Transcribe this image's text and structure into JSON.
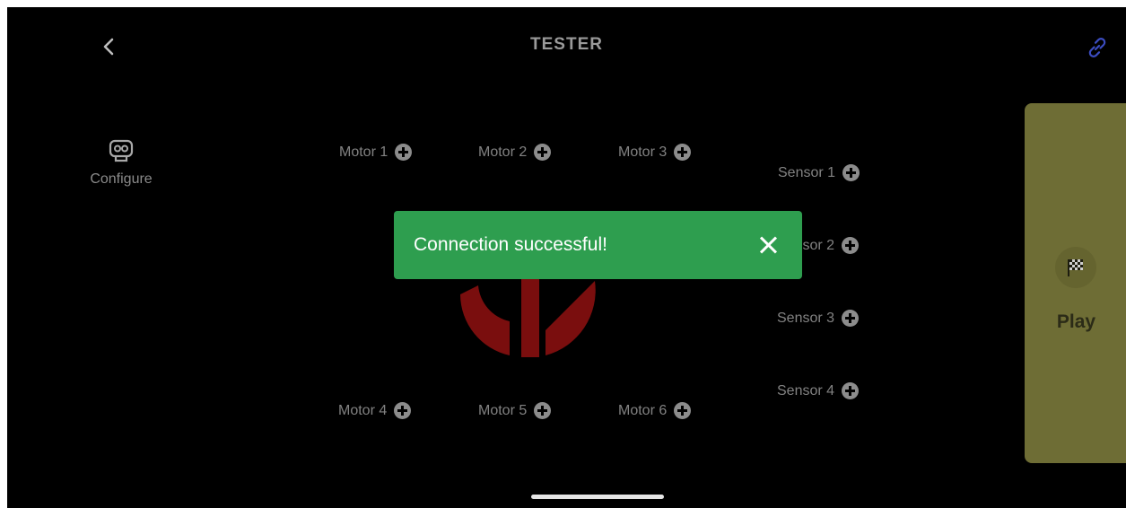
{
  "header": {
    "title": "TESTER",
    "back_icon": "chevron-left-icon",
    "link_icon": "link-icon",
    "link_color": "#3b4cc0"
  },
  "configure": {
    "label": "Configure",
    "icon": "robot-face-icon"
  },
  "motors": [
    {
      "label": "Motor 1"
    },
    {
      "label": "Motor 2"
    },
    {
      "label": "Motor 3"
    },
    {
      "label": "Motor 4"
    },
    {
      "label": "Motor 5"
    },
    {
      "label": "Motor 6"
    }
  ],
  "sensors": [
    {
      "label": "Sensor 1"
    },
    {
      "label": "Sensor 2"
    },
    {
      "label": "Sensor 3"
    },
    {
      "label": "Sensor 4"
    }
  ],
  "toast": {
    "message": "Connection successful!",
    "close_icon": "close-icon",
    "color": "#2e9e4f"
  },
  "play": {
    "label": "Play",
    "icon": "checkered-flag-icon",
    "color": "#6e6d35"
  },
  "logo": {
    "icon": "brand-logo-icon",
    "color": "#7a0e0e"
  }
}
